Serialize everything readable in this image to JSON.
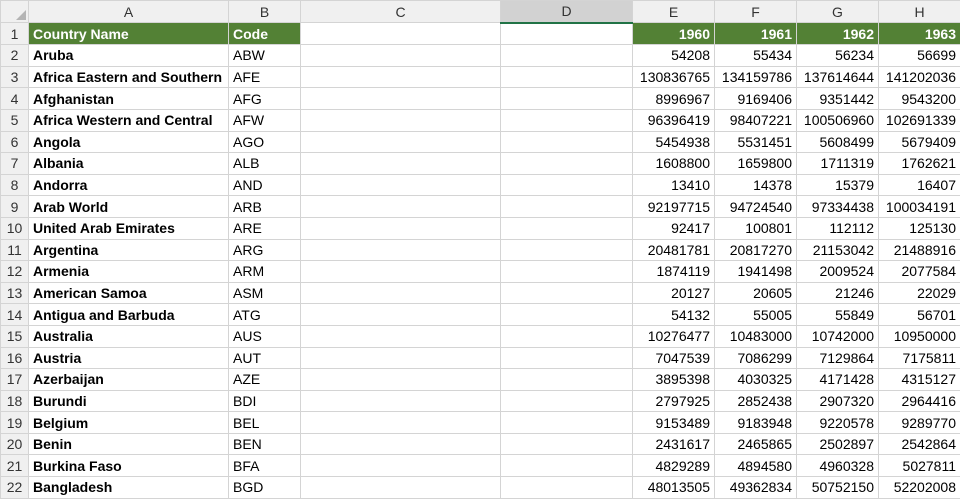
{
  "columns": [
    "A",
    "B",
    "C",
    "D",
    "E",
    "F",
    "G",
    "H"
  ],
  "header_row": {
    "row_number": "1",
    "country_name": "Country Name",
    "code": "Code",
    "years": [
      "1960",
      "1961",
      "1962",
      "1963"
    ]
  },
  "rows": [
    {
      "n": "2",
      "name": "Aruba",
      "code": "ABW",
      "v": [
        "54208",
        "55434",
        "56234",
        "56699"
      ]
    },
    {
      "n": "3",
      "name": "Africa Eastern and Southern",
      "code": "AFE",
      "v": [
        "130836765",
        "134159786",
        "137614644",
        "141202036"
      ]
    },
    {
      "n": "4",
      "name": "Afghanistan",
      "code": "AFG",
      "v": [
        "8996967",
        "9169406",
        "9351442",
        "9543200"
      ]
    },
    {
      "n": "5",
      "name": "Africa Western and Central",
      "code": "AFW",
      "v": [
        "96396419",
        "98407221",
        "100506960",
        "102691339"
      ]
    },
    {
      "n": "6",
      "name": "Angola",
      "code": "AGO",
      "v": [
        "5454938",
        "5531451",
        "5608499",
        "5679409"
      ]
    },
    {
      "n": "7",
      "name": "Albania",
      "code": "ALB",
      "v": [
        "1608800",
        "1659800",
        "1711319",
        "1762621"
      ]
    },
    {
      "n": "8",
      "name": "Andorra",
      "code": "AND",
      "v": [
        "13410",
        "14378",
        "15379",
        "16407"
      ]
    },
    {
      "n": "9",
      "name": "Arab World",
      "code": "ARB",
      "v": [
        "92197715",
        "94724540",
        "97334438",
        "100034191"
      ]
    },
    {
      "n": "10",
      "name": "United Arab Emirates",
      "code": "ARE",
      "v": [
        "92417",
        "100801",
        "112112",
        "125130"
      ]
    },
    {
      "n": "11",
      "name": "Argentina",
      "code": "ARG",
      "v": [
        "20481781",
        "20817270",
        "21153042",
        "21488916"
      ]
    },
    {
      "n": "12",
      "name": "Armenia",
      "code": "ARM",
      "v": [
        "1874119",
        "1941498",
        "2009524",
        "2077584"
      ]
    },
    {
      "n": "13",
      "name": "American Samoa",
      "code": "ASM",
      "v": [
        "20127",
        "20605",
        "21246",
        "22029"
      ]
    },
    {
      "n": "14",
      "name": "Antigua and Barbuda",
      "code": "ATG",
      "v": [
        "54132",
        "55005",
        "55849",
        "56701"
      ]
    },
    {
      "n": "15",
      "name": "Australia",
      "code": "AUS",
      "v": [
        "10276477",
        "10483000",
        "10742000",
        "10950000"
      ]
    },
    {
      "n": "16",
      "name": "Austria",
      "code": "AUT",
      "v": [
        "7047539",
        "7086299",
        "7129864",
        "7175811"
      ]
    },
    {
      "n": "17",
      "name": "Azerbaijan",
      "code": "AZE",
      "v": [
        "3895398",
        "4030325",
        "4171428",
        "4315127"
      ]
    },
    {
      "n": "18",
      "name": "Burundi",
      "code": "BDI",
      "v": [
        "2797925",
        "2852438",
        "2907320",
        "2964416"
      ]
    },
    {
      "n": "19",
      "name": "Belgium",
      "code": "BEL",
      "v": [
        "9153489",
        "9183948",
        "9220578",
        "9289770"
      ]
    },
    {
      "n": "20",
      "name": "Benin",
      "code": "BEN",
      "v": [
        "2431617",
        "2465865",
        "2502897",
        "2542864"
      ]
    },
    {
      "n": "21",
      "name": "Burkina Faso",
      "code": "BFA",
      "v": [
        "4829289",
        "4894580",
        "4960328",
        "5027811"
      ]
    },
    {
      "n": "22",
      "name": "Bangladesh",
      "code": "BGD",
      "v": [
        "48013505",
        "49362834",
        "50752150",
        "52202008"
      ]
    }
  ]
}
